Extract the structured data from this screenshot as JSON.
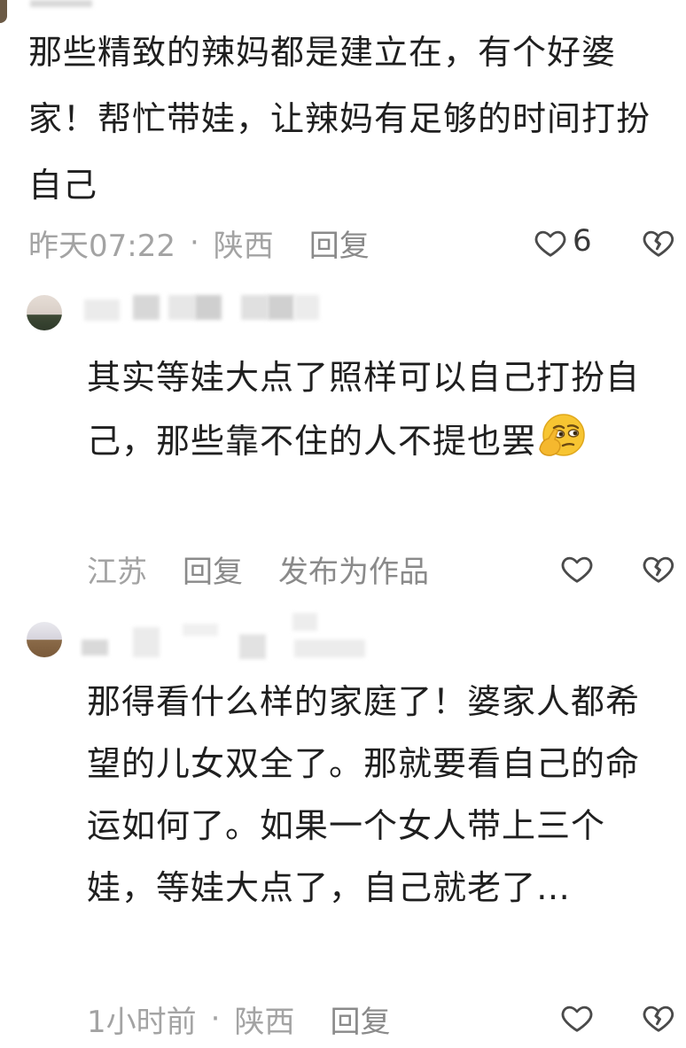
{
  "comments": [
    {
      "text": "那些精致的辣妈都是建立在，有个好婆家！帮忙带娃，让辣妈有足够的时间打扮自己",
      "time": "昨天07:22",
      "dot": "·",
      "location": "陕西",
      "reply": "回复",
      "likes": "6"
    },
    {
      "text": "其实等娃大点了照样可以自己打扮自己，那些靠不住的人不提也罢",
      "location": "江苏",
      "reply": "回复",
      "publish": "发布为作品"
    },
    {
      "text": "那得看什么样的家庭了！婆家人都希望的儿女双全了。那就要看自己的命运如何了。如果一个女人带上三个娃，等娃大点了，自己就老了…",
      "time": "1小时前",
      "dot": "·",
      "location": "陕西",
      "reply": "回复"
    }
  ],
  "icons": {
    "like": "heart-outline-icon",
    "dislike": "broken-heart-icon",
    "emoji": "smirking-thinking-emoji"
  },
  "colors": {
    "text": "#1f1f1f",
    "meta": "#a3a3a3",
    "divider": "#ffffff"
  }
}
